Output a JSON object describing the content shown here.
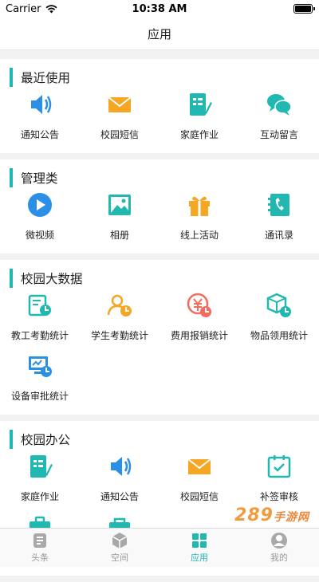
{
  "status_bar": {
    "carrier": "Carrier",
    "time": "10:38 AM"
  },
  "nav": {
    "title": "应用"
  },
  "sections": [
    {
      "title": "最近使用",
      "items": [
        {
          "label": "通知公告",
          "icon": "speaker-icon"
        },
        {
          "label": "校园短信",
          "icon": "envelope-icon"
        },
        {
          "label": "家庭作业",
          "icon": "homework-icon"
        },
        {
          "label": "互动留言",
          "icon": "chat-icon"
        }
      ]
    },
    {
      "title": "管理类",
      "items": [
        {
          "label": "微视频",
          "icon": "play-icon"
        },
        {
          "label": "相册",
          "icon": "album-icon"
        },
        {
          "label": "线上活动",
          "icon": "gift-icon"
        },
        {
          "label": "通讯录",
          "icon": "contacts-icon"
        }
      ]
    },
    {
      "title": "校园大数据",
      "items": [
        {
          "label": "教工考勤统计",
          "icon": "staff-attendance-icon"
        },
        {
          "label": "学生考勤统计",
          "icon": "student-attendance-icon"
        },
        {
          "label": "费用报销统计",
          "icon": "expense-icon"
        },
        {
          "label": "物品领用统计",
          "icon": "goods-icon"
        },
        {
          "label": "设备审批统计",
          "icon": "device-icon"
        }
      ]
    },
    {
      "title": "校园办公",
      "items": [
        {
          "label": "家庭作业",
          "icon": "homework-icon"
        },
        {
          "label": "通知公告",
          "icon": "speaker-icon"
        },
        {
          "label": "校园短信",
          "icon": "envelope-icon"
        },
        {
          "label": "补签审核",
          "icon": "check-calendar-icon"
        }
      ]
    }
  ],
  "tabs": [
    {
      "label": "头条",
      "icon": "headline-icon"
    },
    {
      "label": "空间",
      "icon": "cube-icon"
    },
    {
      "label": "应用",
      "icon": "apps-icon",
      "active": true
    },
    {
      "label": "我的",
      "icon": "profile-icon"
    }
  ],
  "colors": {
    "accent": "#21b8b1",
    "orange": "#f5a623",
    "blue": "#2b8fe6",
    "red": "#f26b5b"
  },
  "watermark": {
    "main": "289",
    "sub": "手游网"
  }
}
